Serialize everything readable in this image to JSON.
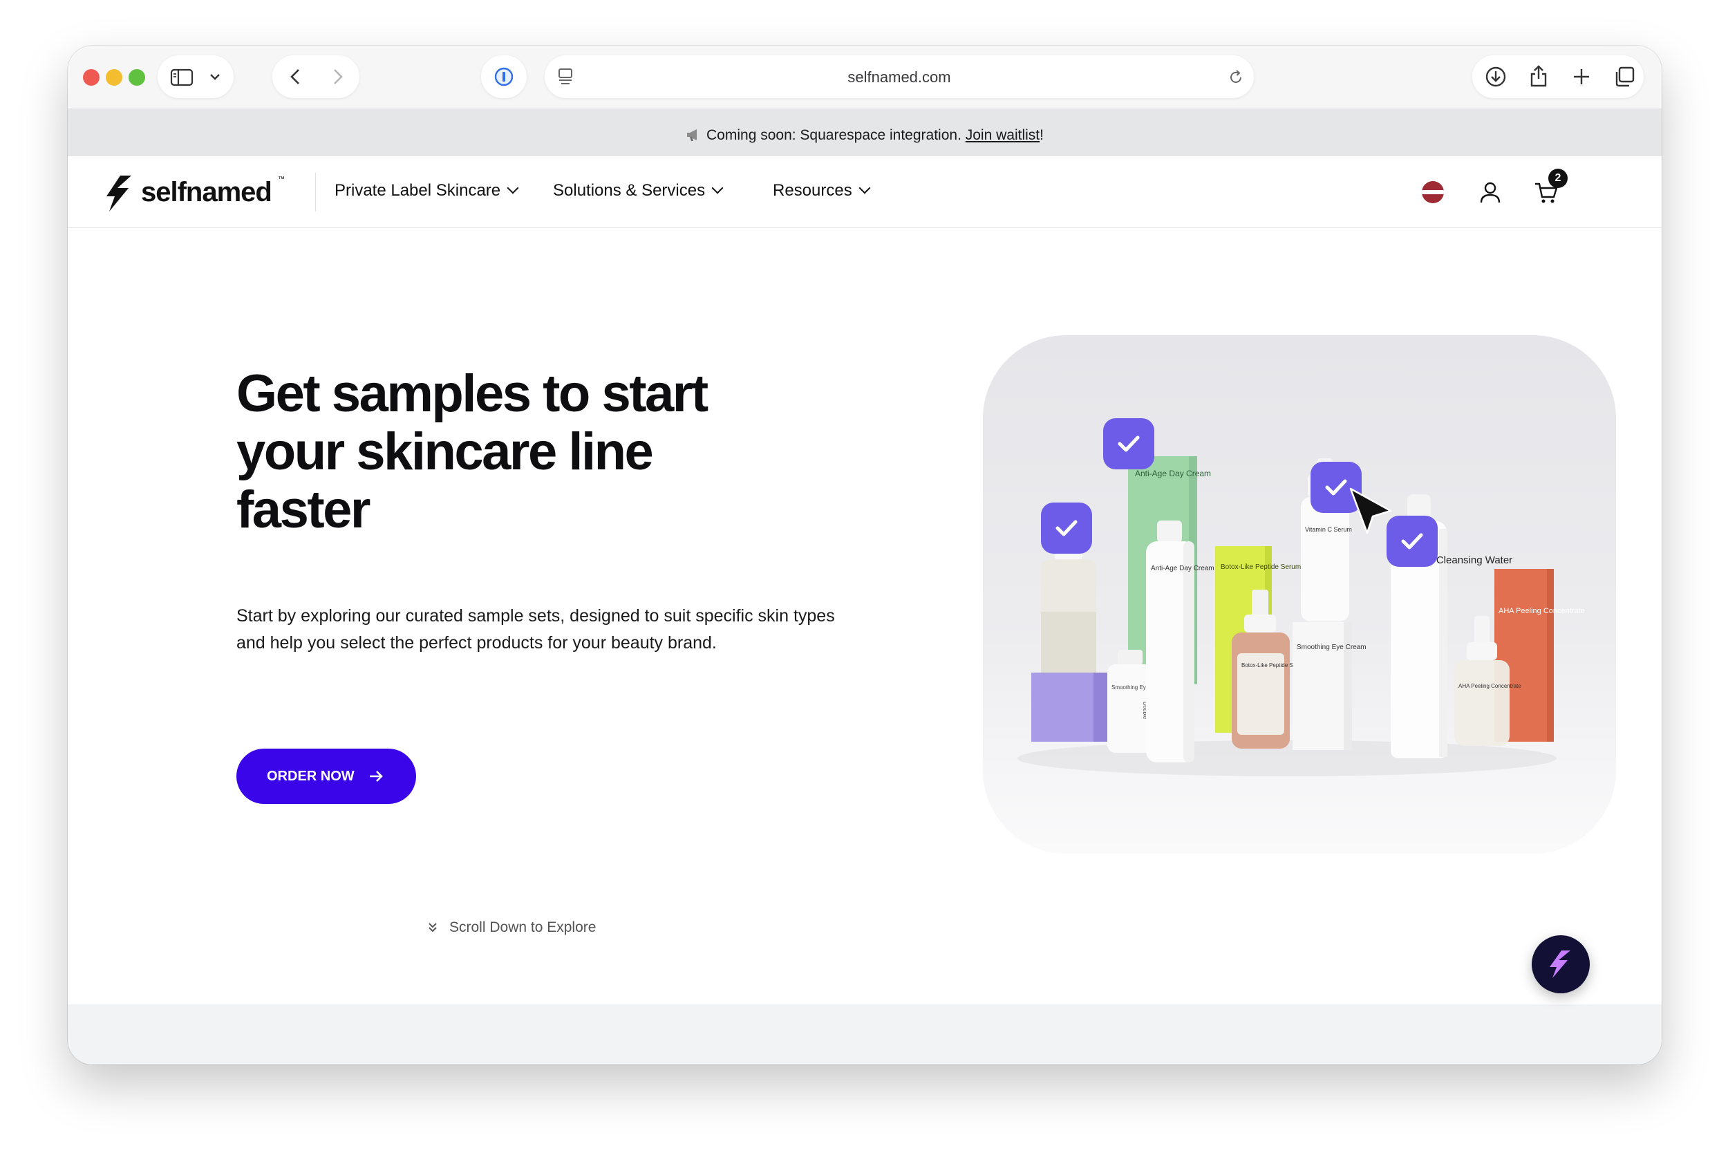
{
  "browser": {
    "url": "selfnamed.com",
    "icons": [
      "sidebar-icon",
      "chevron-down-icon",
      "back-icon",
      "forward-icon",
      "password-manager-icon",
      "reader-icon",
      "reload-icon",
      "download-icon",
      "share-icon",
      "new-tab-icon",
      "tabs-overview-icon"
    ]
  },
  "announcement": {
    "icon": "megaphone-icon",
    "text": "Coming soon: Squarespace integration. ",
    "link": "Join waitlist",
    "suffix": "!"
  },
  "nav": {
    "logo": "selfnamed",
    "logo_tm": "™",
    "items": [
      {
        "label": "Private Label Skincare"
      },
      {
        "label": "Solutions & Services"
      },
      {
        "label": "Resources"
      }
    ],
    "cart_count": "2",
    "icons": [
      "latvia-flag-icon",
      "user-icon",
      "cart-icon"
    ]
  },
  "hero": {
    "title": "Get samples to start your skincare line faster",
    "description": "Start by exploring our curated sample sets, designed to suit specific skin types and help you select the perfect products for your beauty brand.",
    "cta": "ORDER NOW",
    "scroll_hint": "Scroll Down to Explore"
  },
  "products": [
    {
      "name": "Anti-Age Day Cream"
    },
    {
      "name": "Anti-Age Day Cream"
    },
    {
      "name": "Smoothing Eye Cream"
    },
    {
      "name": "Botox-Like Peptide Serum"
    },
    {
      "name": "Botox-Like Peptide Serum"
    },
    {
      "name": "Vitamin C Serum"
    },
    {
      "name": "Smoothing Eye Cream"
    },
    {
      "name": "Micellar Cleansing Water"
    },
    {
      "name": "AHA Peeling Concentrate"
    },
    {
      "name": "AHA Peeling Concentrate"
    },
    {
      "name": "Double"
    }
  ],
  "colors": {
    "accent": "#3a05e8",
    "check_badge": "#6c5ce7",
    "fab": "#121034",
    "green_box": "#9fd6a8",
    "lime_box": "#d9ec4a",
    "orange_box": "#e0704f",
    "lilac_box": "#a99be6"
  }
}
